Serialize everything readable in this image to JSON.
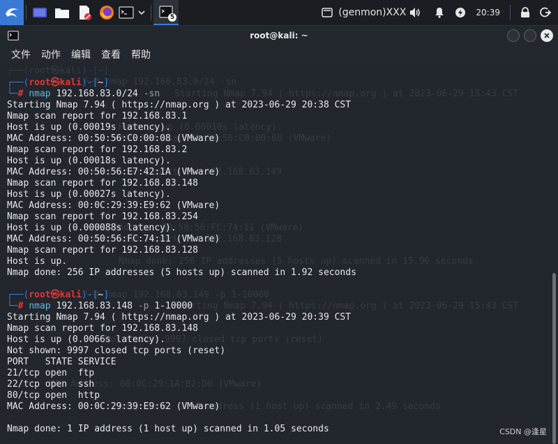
{
  "taskbar": {
    "workspace_badge": "5",
    "genmon": "(genmon)XXX",
    "clock": "20:39"
  },
  "window": {
    "title": "root@kali: ~",
    "menu": [
      "文件",
      "动作",
      "编辑",
      "查看",
      "帮助"
    ]
  },
  "terminal": {
    "prompt1": {
      "user": "root",
      "at": "㉿",
      "host": "kali",
      "dir": "~",
      "hash": "#",
      "cmd": "nmap",
      "args": "192.168.83.0/24",
      "flag": "-sn"
    },
    "output1": [
      "Starting Nmap 7.94 ( https://nmap.org ) at 2023-06-29 20:38 CST",
      "Nmap scan report for 192.168.83.1",
      "Host is up (0.00019s latency).",
      "MAC Address: 00:50:56:C0:00:08 (VMware)",
      "Nmap scan report for 192.168.83.2",
      "Host is up (0.00018s latency).",
      "MAC Address: 00:50:56:E7:42:1A (VMware)",
      "Nmap scan report for 192.168.83.148",
      "Host is up (0.00027s latency).",
      "MAC Address: 00:0C:29:39:E9:62 (VMware)",
      "Nmap scan report for 192.168.83.254",
      "Host is up (0.000088s latency).",
      "MAC Address: 00:50:56:FC:74:11 (VMware)",
      "Nmap scan report for 192.168.83.128",
      "Host is up.",
      "Nmap done: 256 IP addresses (5 hosts up) scanned in 1.92 seconds"
    ],
    "prompt2": {
      "user": "root",
      "at": "㉿",
      "host": "kali",
      "dir": "~",
      "hash": "#",
      "cmd": "nmap",
      "args": "192.168.83.148",
      "flag": "-p",
      "args2": "1-10000"
    },
    "output2": [
      "Starting Nmap 7.94 ( https://nmap.org ) at 2023-06-29 20:39 CST",
      "Nmap scan report for 192.168.83.148",
      "Host is up (0.0066s latency).",
      "Not shown: 9997 closed tcp ports (reset)",
      "PORT   STATE SERVICE",
      "21/tcp open  ftp",
      "22/tcp open  ssh",
      "80/tcp open  http",
      "MAC Address: 00:0C:29:39:E9:62 (VMware)",
      "",
      "Nmap done: 1 IP address (1 host up) scanned in 1.05 seconds"
    ],
    "ghost_lines": [
      "┌──(root㉿kali)-[~]",
      "└─# nmap 192.168.83.0/24 -sn",
      "Starting Nmap 7.94 ( https://nmap.org ) at 2023-06-29 15:43 CST",
      "Host is up (0.00019s latency).",
      "MAC Address: 00:50:56:C0:00:08 (VMware)",
      "Nmap scan report for 192.168.83.149",
      "MAC Address: 00:50:56:FC:74:11 (VMware)",
      "Nmap scan report for 192.168.83.128",
      "Nmap done: 256 IP addresses (5 hosts up) scanned in 15.96 seconds",
      "└─# nmap 192.168.83.149 -p 1-10000",
      "Starting Nmap 7.94 ( https://nmap.org ) at 2023-06-29 15:43 CST",
      "Not shown: 9997 closed tcp ports (reset)",
      "MAC Address: 00:0C:29:1A:B2:D0 (VMware)",
      "Nmap done: 1 IP address (1 host up) scanned in 2.49 seconds"
    ]
  },
  "watermark": "CSDN @逢星",
  "colors": {
    "background": "#22262d",
    "prompt_blue": "#2f7ee0",
    "prompt_red": "#e43535",
    "command": "#66b8d6"
  }
}
